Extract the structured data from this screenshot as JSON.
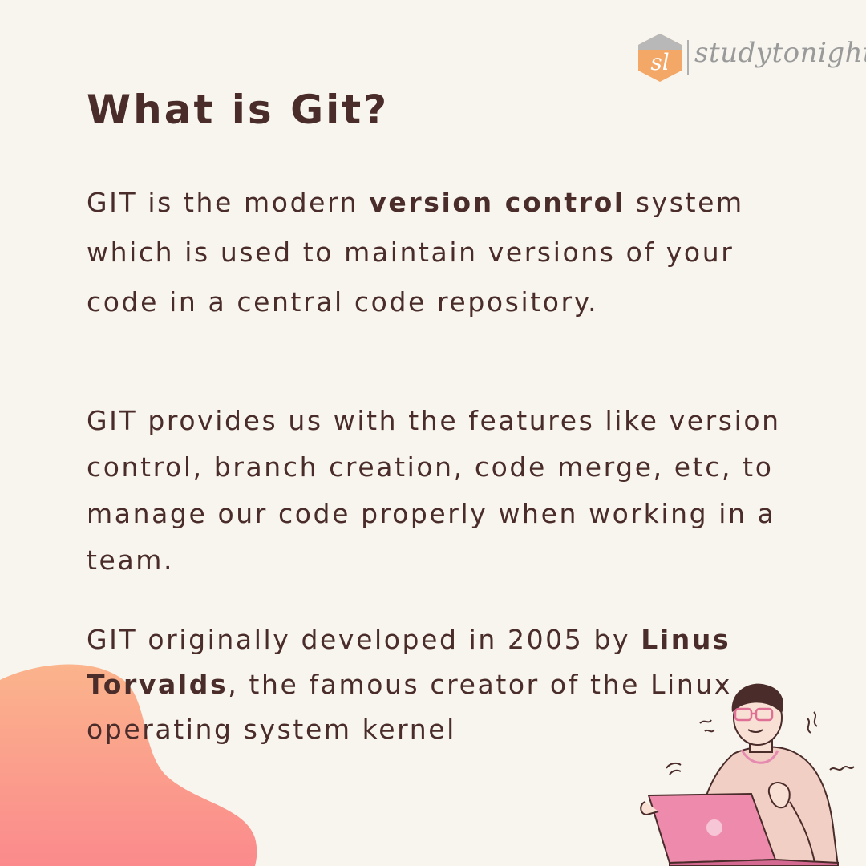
{
  "brand": {
    "logo_mark": "sl",
    "name": "studytonight",
    "colors": {
      "logo_hexagon": "#f4a868",
      "logo_hexagon_top": "#b8b8b8",
      "logo_text": "#9a9a9a"
    }
  },
  "title": "What is Git?",
  "paragraphs": {
    "p1": {
      "before": "GIT is the modern ",
      "bold": "version control",
      "after": " system which is used to maintain versions of your code in a central code repository."
    },
    "p2": {
      "text": "GIT provides us with the features like version control, branch creation, code merge, etc, to manage our code properly when working in a team."
    },
    "p3": {
      "before": "GIT originally developed in 2005 by ",
      "bold": "Linus Torvalds",
      "after": ", the famous creator of the Linux operating system kernel"
    }
  },
  "colors": {
    "background": "#f7f5ee",
    "text": "#4a2c2a",
    "blob_top": "#fbb08a",
    "blob_bottom": "#fb8a8a",
    "laptop": "#ee8aac"
  },
  "decorations": {
    "illustration": "person-with-laptop-illustration"
  }
}
